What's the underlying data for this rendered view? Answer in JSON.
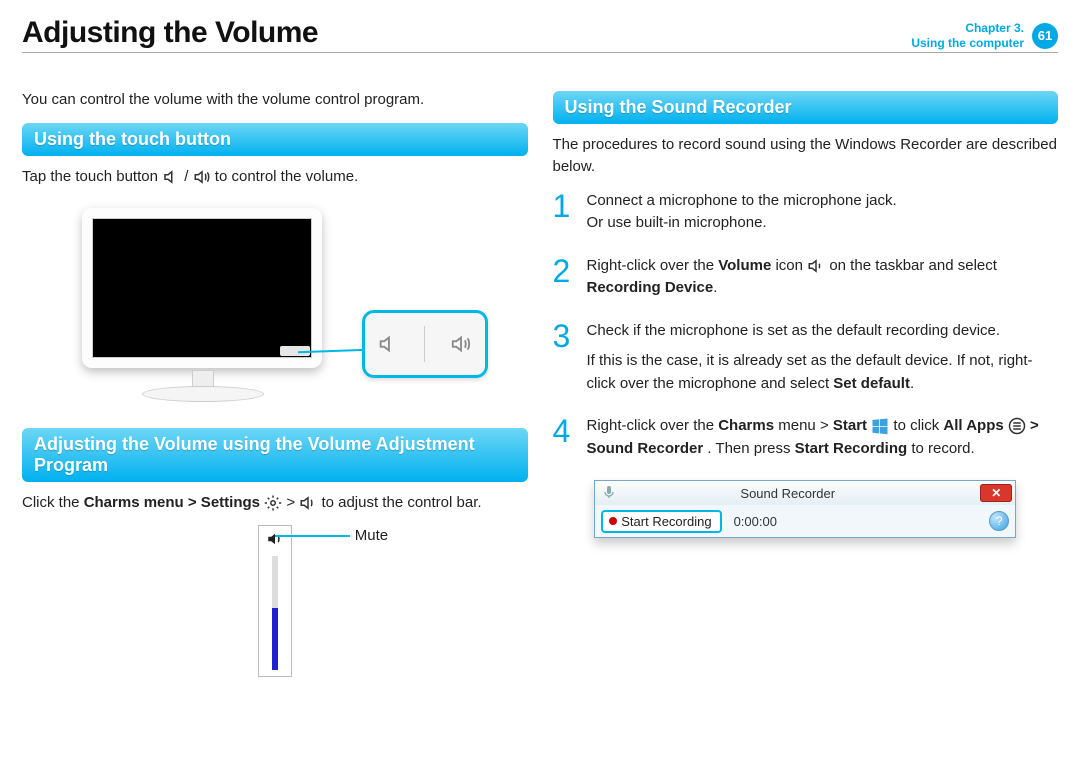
{
  "header": {
    "title": "Adjusting the Volume",
    "chapter_line1": "Chapter 3.",
    "chapter_line2": "Using the computer",
    "page_number": "61"
  },
  "left": {
    "intro": "You can control the volume with the volume control program.",
    "sec1_title": "Using the touch button",
    "sec1_text_a": "Tap the touch button ",
    "sec1_text_b": " / ",
    "sec1_text_c": " to control the volume.",
    "sec2_title": "Adjusting the Volume using the Volume Adjustment Program",
    "sec2_text_a": "Click the ",
    "sec2_bold1": "Charms menu > Settings",
    "sec2_text_b": " > ",
    "sec2_text_c": " to adjust the control bar.",
    "mute_label": "Mute"
  },
  "right": {
    "sec3_title": "Using the Sound Recorder",
    "sec3_intro": "The procedures to record sound using the Windows Recorder are described below.",
    "steps": [
      {
        "num": "1",
        "line1": "Connect a microphone to the microphone jack.",
        "line2": "Or use built-in microphone."
      },
      {
        "num": "2",
        "pre": "Right-click over the ",
        "bold1": "Volume",
        "mid": " icon ",
        "post": " on the taskbar and select ",
        "bold2": "Recording Device",
        "end": "."
      },
      {
        "num": "3",
        "line1": "Check if the microphone is set as the default recording device.",
        "line2a": "If this is the case, it is already set as the default device. If not, right-click over the microphone and select ",
        "bold": "Set default",
        "line2b": "."
      },
      {
        "num": "4",
        "a": "Right-click over the ",
        "b": "Charms",
        "c": " menu > ",
        "d": "Start",
        "e": " to click ",
        "f": "All Apps",
        "g": " > ",
        "h": "Sound Recorder",
        "i": ". Then press ",
        "j": "Start Recording",
        "k": " to record."
      }
    ],
    "recorder": {
      "title": "Sound Recorder",
      "button": "Start Recording",
      "time": "0:00:00",
      "close": "✕",
      "help": "?"
    }
  }
}
